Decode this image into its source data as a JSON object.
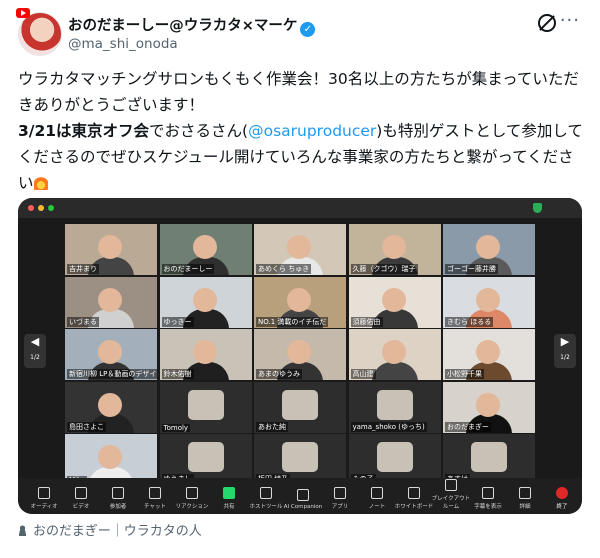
{
  "post": {
    "display_name": "おのだまーしー@ウラカタ×マーケ",
    "handle": "@ma_shi_onoda",
    "text": {
      "line1": "ウラカタマッチングサロンもくもく作業会！30名以上の方たちが集まっていただきありがとうございます！",
      "date_bold": "3/21は東京オフ会",
      "after_date": "でおさるさん(",
      "mention": "@osaruproducer",
      "after_mention": ")も特別ゲストとして参加してくださるのでぜひスケジュール開けていろんな事業家の方たちと繋がってください"
    },
    "footer_label": "おのだまぎー｜ウラカタの人"
  },
  "zoom": {
    "page_left": "1/2",
    "page_right": "1/2",
    "tiles": [
      {
        "label": "吉井まり"
      },
      {
        "label": "おのだまーしー"
      },
      {
        "label": "あめくら ちゅき"
      },
      {
        "label": "久藤（クゴウ）瑞子"
      },
      {
        "label": "ゴーゴー藤井勝"
      },
      {
        "label": "いづまる"
      },
      {
        "label": "ゆっきー"
      },
      {
        "label": "NO.1 満載のイチ伝だ"
      },
      {
        "label": "須藤佑由"
      },
      {
        "label": "きむら ほるる"
      },
      {
        "label": "新宿川柳 LP＆動画のデザイナー"
      },
      {
        "label": "鈴木佑樹"
      },
      {
        "label": "あまのゆうみ"
      },
      {
        "label": "高山建"
      },
      {
        "label": "小松野千果"
      },
      {
        "label": "島田さよこ"
      },
      {
        "label": "Tomoly"
      },
      {
        "label": "あおた純"
      },
      {
        "label": "yama_shoko (ゆっち)"
      },
      {
        "label": "おのだまぎー"
      },
      {
        "label": "Miko"
      },
      {
        "label": "ゆうまし"
      },
      {
        "label": "板田 綾乃"
      },
      {
        "label": "みの子"
      },
      {
        "label": "あすけ"
      }
    ],
    "toolbar": [
      {
        "label": "オーディオ"
      },
      {
        "label": "ビデオ"
      },
      {
        "label": "参加者"
      },
      {
        "label": "チャット"
      },
      {
        "label": "リアクション"
      },
      {
        "label": "共有"
      },
      {
        "label": "ホストツール"
      },
      {
        "label": "AI Companion"
      },
      {
        "label": "アプリ"
      },
      {
        "label": "ノート"
      },
      {
        "label": "ホワイトボード"
      },
      {
        "label": "ブレイクアウト ルーム"
      },
      {
        "label": "字幕を表示"
      },
      {
        "label": "詳細"
      },
      {
        "label": "終了"
      }
    ]
  },
  "colors": {
    "link": "#1d9bf0",
    "verified": "#1d9bf0",
    "end_button": "#e02828",
    "share_button": "#23d86d"
  }
}
